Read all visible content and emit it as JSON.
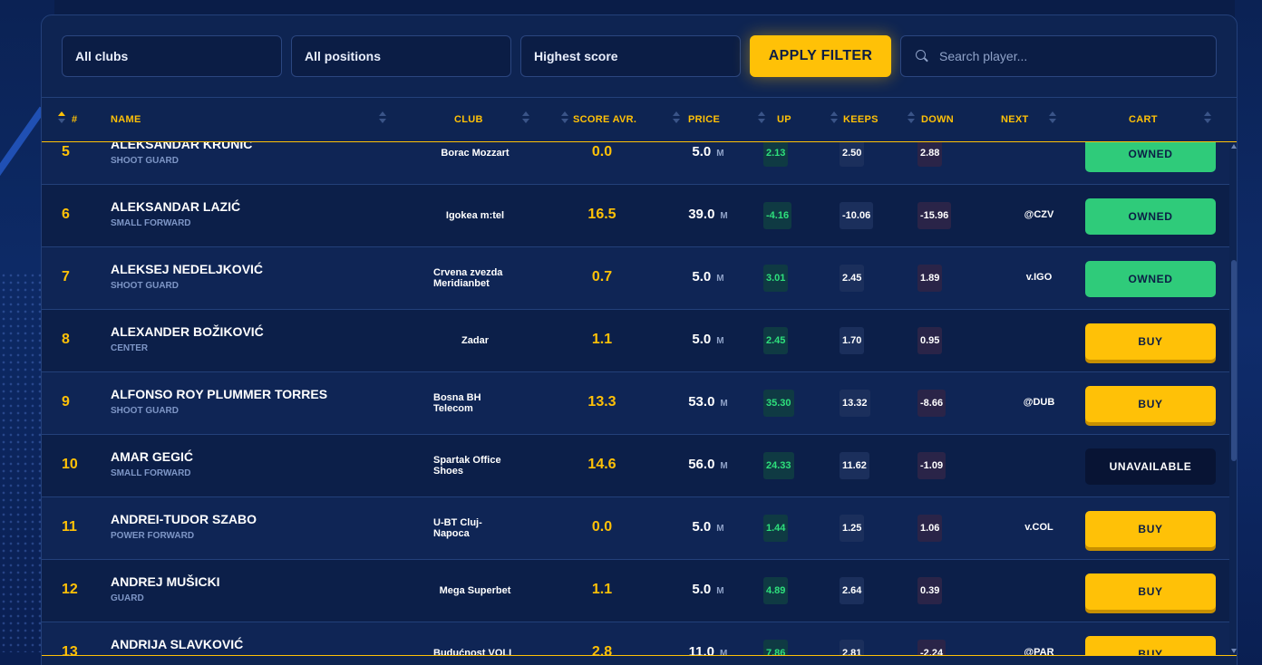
{
  "filters": {
    "clubs": "All clubs",
    "positions": "All positions",
    "sort": "Highest score",
    "apply_label": "APPLY FILTER",
    "search_placeholder": "Search player..."
  },
  "columns": {
    "rank": "#",
    "name": "NAME",
    "club": "CLUB",
    "score": "SCORE AVR.",
    "price": "PRICE",
    "up": "UP",
    "keeps": "KEEPS",
    "down": "DOWN",
    "next": "NEXT",
    "cart": "CART"
  },
  "price_unit": "M",
  "rows": [
    {
      "rank": "5",
      "name": "ALEKSANDAR KRUNIĆ",
      "position": "SHOOT GUARD",
      "club": "Borac Mozzart",
      "score": "0.0",
      "price": "5.0",
      "up": "2.13",
      "keeps": "2.50",
      "down": "2.88",
      "next": "",
      "cart": "OWNED"
    },
    {
      "rank": "6",
      "name": "ALEKSANDAR LAZIĆ",
      "position": "SMALL FORWARD",
      "club": "Igokea m:tel",
      "score": "16.5",
      "price": "39.0",
      "up": "-4.16",
      "keeps": "-10.06",
      "down": "-15.96",
      "next": "@CZV",
      "cart": "OWNED"
    },
    {
      "rank": "7",
      "name": "ALEKSEJ NEDELJKOVIĆ",
      "position": "SHOOT GUARD",
      "club": "Crvena zvezda Meridianbet",
      "score": "0.7",
      "price": "5.0",
      "up": "3.01",
      "keeps": "2.45",
      "down": "1.89",
      "next": "v.IGO",
      "cart": "OWNED"
    },
    {
      "rank": "8",
      "name": "ALEXANDER BOŽIKOVIĆ",
      "position": "CENTER",
      "club": "Zadar",
      "score": "1.1",
      "price": "5.0",
      "up": "2.45",
      "keeps": "1.70",
      "down": "0.95",
      "next": "",
      "cart": "BUY"
    },
    {
      "rank": "9",
      "name": "ALFONSO ROY PLUMMER TORRES",
      "position": "SHOOT GUARD",
      "club": "Bosna BH Telecom",
      "score": "13.3",
      "price": "53.0",
      "up": "35.30",
      "keeps": "13.32",
      "down": "-8.66",
      "next": "@DUB",
      "cart": "BUY"
    },
    {
      "rank": "10",
      "name": "AMAR GEGIĆ",
      "position": "SMALL FORWARD",
      "club": "Spartak Office Shoes",
      "score": "14.6",
      "price": "56.0",
      "up": "24.33",
      "keeps": "11.62",
      "down": "-1.09",
      "next": "",
      "cart": "UNAVAILABLE"
    },
    {
      "rank": "11",
      "name": "ANDREI-TUDOR SZABO",
      "position": "POWER FORWARD",
      "club": "U-BT Cluj-Napoca",
      "score": "0.0",
      "price": "5.0",
      "up": "1.44",
      "keeps": "1.25",
      "down": "1.06",
      "next": "v.COL",
      "cart": "BUY"
    },
    {
      "rank": "12",
      "name": "ANDREJ MUŠICKI",
      "position": "GUARD",
      "club": "Mega Superbet",
      "score": "1.1",
      "price": "5.0",
      "up": "4.89",
      "keeps": "2.64",
      "down": "0.39",
      "next": "",
      "cart": "BUY"
    },
    {
      "rank": "13",
      "name": "ANDRIJA SLAVKOVIĆ",
      "position": "",
      "club": "Budućnost VOLI",
      "score": "2.8",
      "price": "11.0",
      "up": "7.86",
      "keeps": "2.81",
      "down": "-2.24",
      "next": "@PAR",
      "cart": "BUY"
    }
  ],
  "colors": {
    "accent": "#ffc107",
    "owned": "#2fcb7a",
    "background": "#0e2452"
  }
}
